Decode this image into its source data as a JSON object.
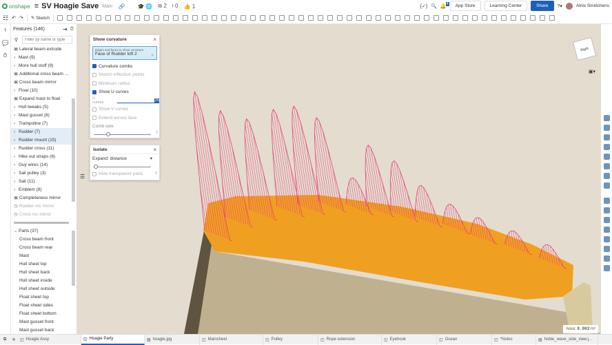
{
  "header": {
    "brand": "onshape",
    "doc_title": "SV Hoagie Save",
    "branch": "Main",
    "versions_count": "2",
    "branches_count": "0",
    "likes_count": "1",
    "notifications": "4",
    "app_store": "App Store",
    "learning_center": "Learning Center",
    "share": "Share",
    "user": "Alnis Smidchens"
  },
  "toolbar": {
    "sketch": "Sketch"
  },
  "features": {
    "title": "Features (146)",
    "filter_placeholder": "Filter by name or type",
    "items": [
      {
        "label": "Lateral beam extrude",
        "type": "feature"
      },
      {
        "label": "Mast (9)",
        "type": "folder"
      },
      {
        "label": "More hull stuff (9)",
        "type": "folder"
      },
      {
        "label": "Additional cross beam ...",
        "type": "feature"
      },
      {
        "label": "Cross beam mirror",
        "type": "feature"
      },
      {
        "label": "Float (10)",
        "type": "folder"
      },
      {
        "label": "Expand mast to float",
        "type": "feature"
      },
      {
        "label": "Hull tweaks (5)",
        "type": "folder"
      },
      {
        "label": "Mast gusset (8)",
        "type": "folder"
      },
      {
        "label": "Trampoline (7)",
        "type": "folder"
      },
      {
        "label": "Rudder (7)",
        "type": "folder",
        "selected": true
      },
      {
        "label": "Rudder mount (15)",
        "type": "folder",
        "selected": true
      },
      {
        "label": "Rudder cross (11)",
        "type": "folder"
      },
      {
        "label": "Hike out straps (6)",
        "type": "folder"
      },
      {
        "label": "Guy wires (14)",
        "type": "folder"
      },
      {
        "label": "Sail pulley (3)",
        "type": "folder"
      },
      {
        "label": "Sail (11)",
        "type": "folder"
      },
      {
        "label": "Emblem (8)",
        "type": "folder"
      },
      {
        "label": "Completeness mirror",
        "type": "feature"
      },
      {
        "label": "Rudder mc mirror",
        "type": "suppressed"
      },
      {
        "label": "Cross mc mirror",
        "type": "suppressed"
      }
    ]
  },
  "parts": {
    "title": "Parts (37)",
    "items": [
      "Cross beam front",
      "Cross beam rear",
      "Mast",
      "Hull sheet top",
      "Hull sheet back",
      "Hull sheet inside",
      "Hull sheet outside",
      "Float sheet top",
      "Float sheet sides",
      "Float sheet bottom",
      "Mast gusset front",
      "Mast gusset back"
    ]
  },
  "curvature": {
    "title": "Show curvature",
    "selection_label": "Edges and faces to show curvature",
    "selection_value": "Face of Rudder loft 2",
    "curvature_combs": "Curvature combs",
    "sketch_inflection": "Sketch inflection points",
    "minimum_radius": "Minimum radius",
    "show_u": "Show U curves",
    "u_curves_label": "U curves",
    "u_curves_value": "15",
    "show_v": "Show V curves",
    "extend": "Extend across face",
    "comb_size": "Comb size",
    "comb_size_fraction": 0.1
  },
  "isolate": {
    "title": "Isolate",
    "mode": "Expand: distance",
    "hide_transparent": "Hide transparent parts",
    "distance_fraction": 0
  },
  "viewcube": {
    "label": "Right"
  },
  "area": {
    "label": "Area:",
    "value": "0.003",
    "unit": "m²"
  },
  "tabs": [
    "Hoagie Assy",
    "Hoagie Party",
    "hoagie.jpg",
    "Mainsheet",
    "Pulley",
    "Rope extension",
    "Eyehook",
    "Ocean",
    "*Notes",
    "hobie_wave_side_view.j..."
  ],
  "active_tab": 1,
  "colors": {
    "accent": "#1f5fb8",
    "face": "#f0a020",
    "comb": "#e8407a",
    "viewport": "#e3dccf"
  }
}
